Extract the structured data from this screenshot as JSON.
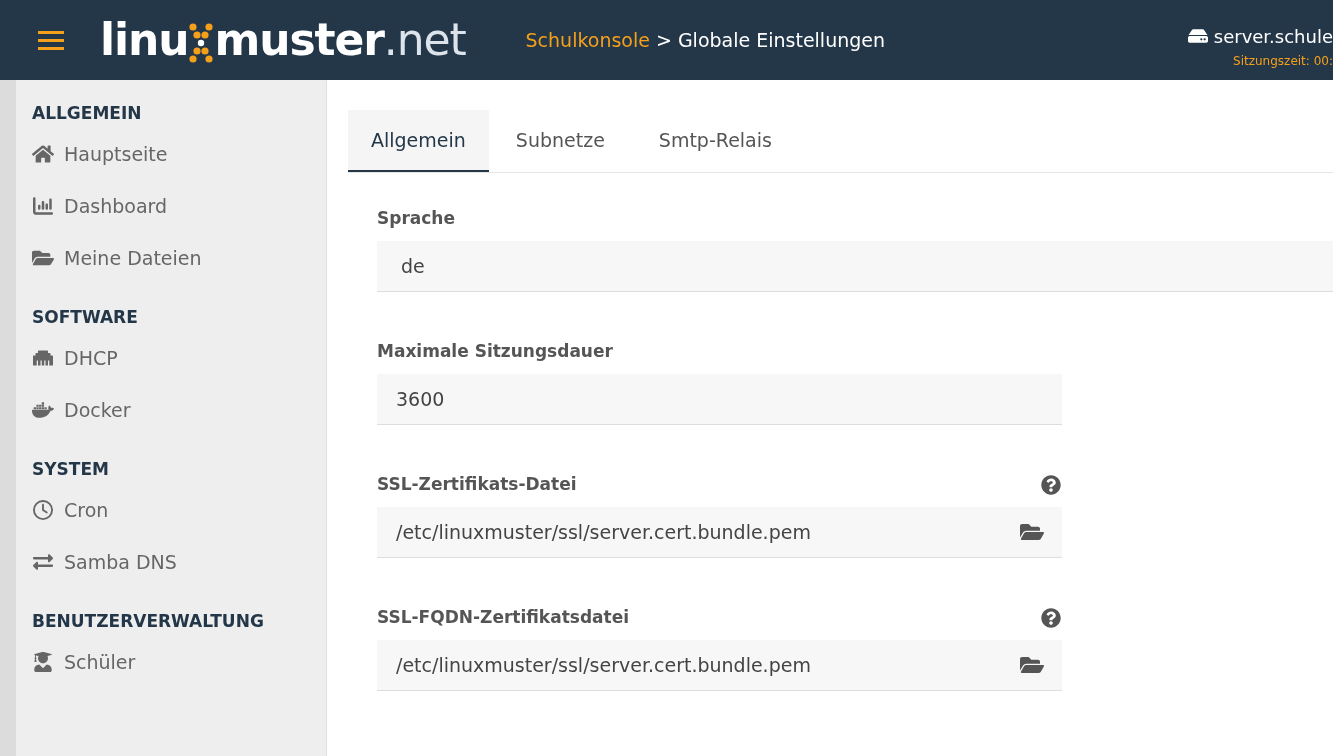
{
  "header": {
    "logo": {
      "part_1": "linu",
      "part_2": "muster",
      "part_3": ".net"
    },
    "breadcrumb": [
      {
        "label": "Schulkonsole",
        "kind": "link"
      },
      {
        "label": "> Globale Einstellungen",
        "kind": "current"
      }
    ],
    "server": "server.schule",
    "session": "Sitzungszeit: 00:"
  },
  "sidebar": {
    "sections": [
      {
        "title": "ALLGEMEIN",
        "items": [
          {
            "label": "Hauptseite"
          },
          {
            "label": "Dashboard"
          },
          {
            "label": "Meine Dateien"
          }
        ]
      },
      {
        "title": "SOFTWARE",
        "items": [
          {
            "label": "DHCP"
          },
          {
            "label": "Docker"
          }
        ]
      },
      {
        "title": "SYSTEM",
        "items": [
          {
            "label": "Cron"
          },
          {
            "label": "Samba DNS"
          }
        ]
      },
      {
        "title": "BENUTZERVERWALTUNG",
        "items": [
          {
            "label": "Schüler"
          }
        ]
      }
    ]
  },
  "tabs": [
    {
      "label": "Allgemein",
      "selected": true
    },
    {
      "label": "Subnetze",
      "selected": false
    },
    {
      "label": "Smtp-Relais",
      "selected": false
    }
  ],
  "fields": [
    {
      "label": "Sprache",
      "value": "de",
      "kind": "select"
    },
    {
      "label": "Maximale Sitzungsdauer",
      "value": "3600",
      "kind": "text"
    },
    {
      "label": "SSL-Zertifikats-Datei",
      "value": "/etc/linuxmuster/ssl/server.cert.bundle.pem",
      "kind": "file"
    },
    {
      "label": "SSL-FQDN-Zertifikatsdatei",
      "value": "/etc/linuxmuster/ssl/server.cert.bundle.pem",
      "kind": "file"
    }
  ]
}
